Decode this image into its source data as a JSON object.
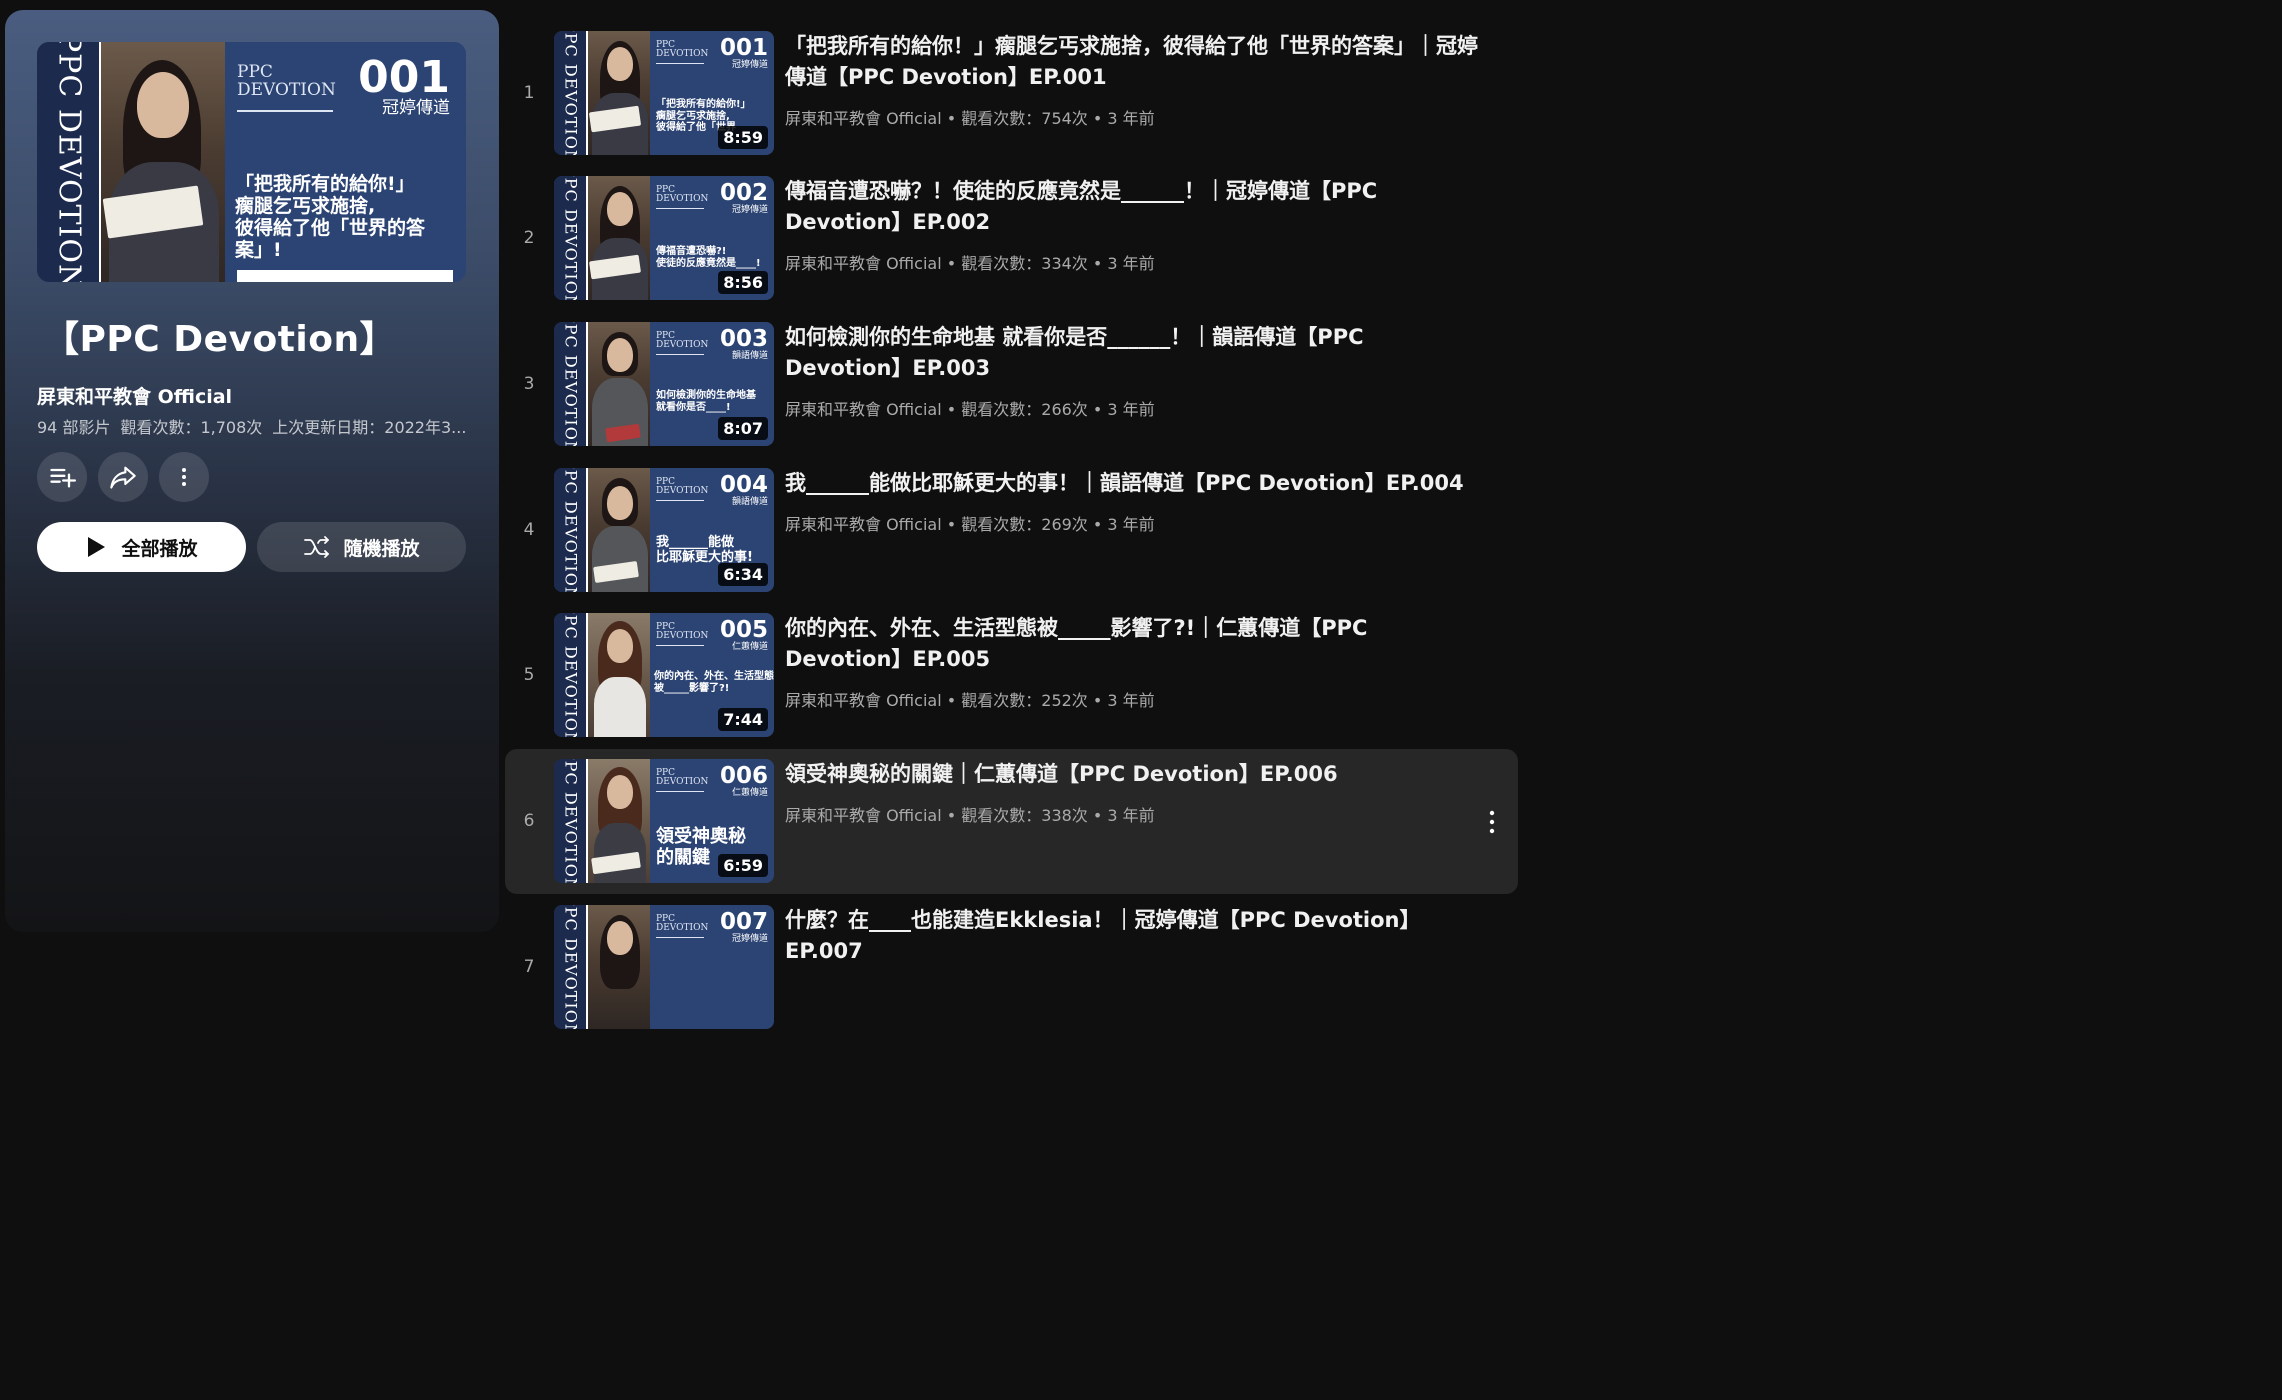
{
  "playlist": {
    "title": "【PPC Devotion】",
    "channel": "屏東和平教會 Official",
    "video_count": "94 部影片",
    "views": "觀看次數：1,708次",
    "updated": "上次更新日期：2022年3...",
    "play_all_label": "全部播放",
    "shuffle_label": "隨機播放",
    "thumbnail": {
      "stripe": "PPC DEVOTION",
      "brand_1": "PPC",
      "brand_2": "DEVOTION",
      "episode": "001",
      "host": "冠婷傳道",
      "caption": "「把我所有的給你!」\n瘸腿乞丐求施捨,\n彼得給了他「世界的答案」!"
    }
  },
  "videos": [
    {
      "index": "1",
      "title": "「把我所有的給你！」瘸腿乞丐求施捨，彼得給了他「世界的答案」｜冠婷傳道【PPC Devotion】EP.001",
      "channel": "屏東和平教會 Official",
      "stats": "觀看次數：754次 • 3 年前",
      "duration": "8:59",
      "thumb": {
        "stripe": "PPC DEVOTION",
        "brand_1": "PPC",
        "brand_2": "DEVOTION",
        "episode": "001",
        "host": "冠婷傳道",
        "caption": "「把我所有的給你!」\n瘸腿乞丐求施捨,\n彼得給了他「世界"
      }
    },
    {
      "index": "2",
      "title": "傳福音遭恐嚇？！使徒的反應竟然是______！｜冠婷傳道【PPC Devotion】EP.002",
      "channel": "屏東和平教會 Official",
      "stats": "觀看次數：334次 • 3 年前",
      "duration": "8:56",
      "thumb": {
        "stripe": "PPC DEVOTION",
        "brand_1": "PPC",
        "brand_2": "DEVOTION",
        "episode": "002",
        "host": "冠婷傳道",
        "caption": "傳福音遭恐嚇?!\n使徒的反應竟然是____!"
      }
    },
    {
      "index": "3",
      "title": "如何檢測你的生命地基 就看你是否______！｜韻語傳道【PPC Devotion】EP.003",
      "channel": "屏東和平教會 Official",
      "stats": "觀看次數：266次 • 3 年前",
      "duration": "8:07",
      "thumb": {
        "stripe": "PPC DEVOTION",
        "brand_1": "PPC",
        "brand_2": "DEVOTION",
        "episode": "003",
        "host": "韻語傳道",
        "caption": "如何檢測你的生命地基\n就看你是否____!"
      }
    },
    {
      "index": "4",
      "title": "我______能做比耶穌更大的事！｜韻語傳道【PPC Devotion】EP.004",
      "channel": "屏東和平教會 Official",
      "stats": "觀看次數：269次 • 3 年前",
      "duration": "6:34",
      "thumb": {
        "stripe": "PPC DEVOTION",
        "brand_1": "PPC",
        "brand_2": "DEVOTION",
        "episode": "004",
        "host": "韻語傳道",
        "caption": "我______能做\n比耶穌更大的事!"
      }
    },
    {
      "index": "5",
      "title": "你的內在、外在、生活型態被_____影響了?!｜仁蕙傳道【PPC Devotion】EP.005",
      "channel": "屏東和平教會 Official",
      "stats": "觀看次數：252次 • 3 年前",
      "duration": "7:44",
      "thumb": {
        "stripe": "PPC DEVOTION",
        "brand_1": "PPC",
        "brand_2": "DEVOTION",
        "episode": "005",
        "host": "仁蕙傳道",
        "caption": "你的內在、外在、生活型態\n被_____影響了?!"
      }
    },
    {
      "index": "6",
      "title": "領受神奧秘的關鍵｜仁蕙傳道【PPC Devotion】EP.006",
      "channel": "屏東和平教會 Official",
      "stats": "觀看次數：338次 • 3 年前",
      "duration": "6:59",
      "thumb": {
        "stripe": "PPC DEVOTION",
        "brand_1": "PPC",
        "brand_2": "DEVOTION",
        "episode": "006",
        "host": "仁蕙傳道",
        "caption": "領受神奧秘\n的關鍵"
      }
    },
    {
      "index": "7",
      "title": "什麼？在____也能建造Ekklesia！｜冠婷傳道【PPC Devotion】EP.007",
      "channel": "",
      "stats": "",
      "duration": "",
      "thumb": {
        "stripe": "PPC DEVOTION",
        "brand_1": "PPC",
        "brand_2": "DEVOTION",
        "episode": "007",
        "host": "冠婷傳道",
        "caption": ""
      }
    }
  ],
  "icons": {
    "save": "add-to-queue-icon",
    "share": "share-icon",
    "more": "more-vert-icon",
    "play": "play-icon",
    "shuffle": "shuffle-icon",
    "item_menu": "more-vert-icon"
  },
  "colors": {
    "background": "#0f0f0f",
    "panel_top": "#4a5d80",
    "thumbnail_blue": "#2c4474",
    "selected_row": "#272727"
  }
}
